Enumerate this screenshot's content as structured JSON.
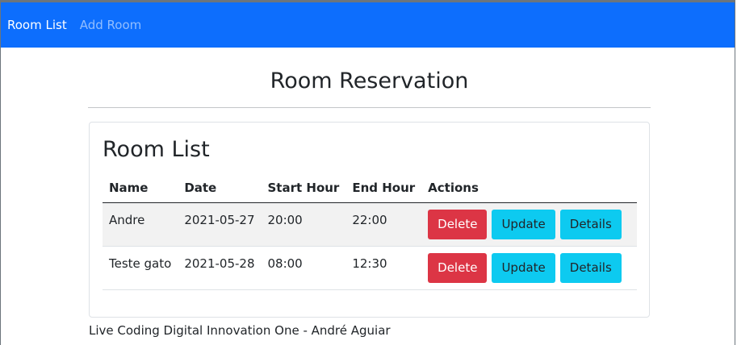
{
  "nav": {
    "items": [
      {
        "label": "Room List",
        "active": true
      },
      {
        "label": "Add Room",
        "active": false
      }
    ],
    "background": "#0d6efd"
  },
  "page": {
    "title": "Room Reservation"
  },
  "card": {
    "title": "Room List",
    "columns": [
      "Name",
      "Date",
      "Start Hour",
      "End Hour",
      "Actions"
    ],
    "rows": [
      {
        "name": "Andre",
        "date": "2021-05-27",
        "start": "20:00",
        "end": "22:00"
      },
      {
        "name": "Teste gato",
        "date": "2021-05-28",
        "start": "08:00",
        "end": "12:30"
      }
    ],
    "actions": {
      "delete": "Delete",
      "update": "Update",
      "details": "Details"
    }
  },
  "footer": {
    "text": "Live Coding Digital Innovation One - André Aguiar"
  },
  "colors": {
    "primary": "#0d6efd",
    "danger": "#dc3545",
    "info": "#0dcaf0"
  }
}
